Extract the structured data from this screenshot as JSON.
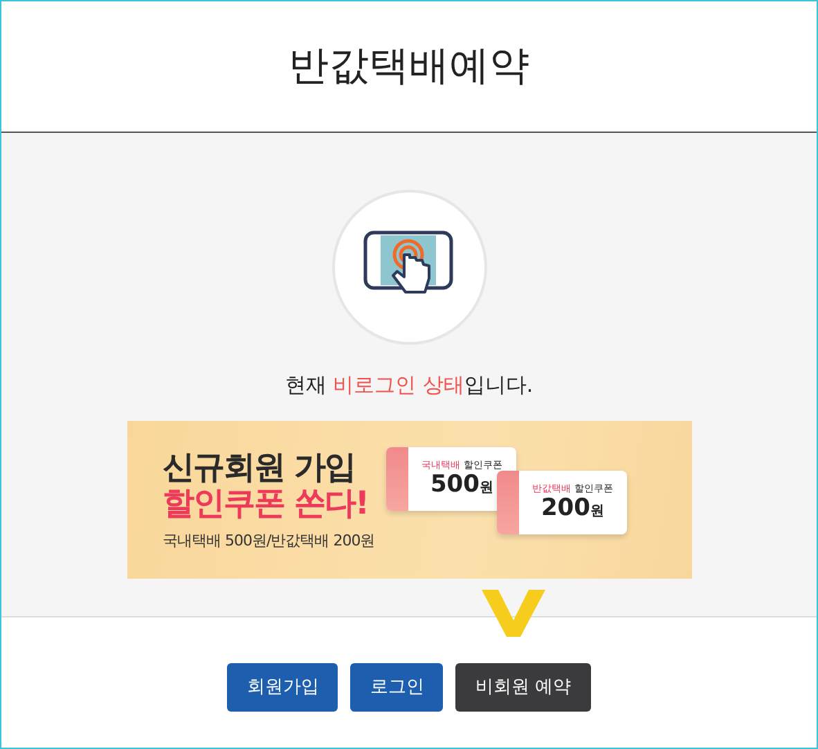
{
  "header": {
    "title": "반값택배예약"
  },
  "status": {
    "prefix": "현재 ",
    "highlight": "비로그인 상태",
    "suffix": "입니다."
  },
  "banner": {
    "headline": "신규회원 가입",
    "subheadline": "할인쿠폰 쏜다!",
    "caption": "국내택배 500원/반값택배 200원",
    "coupons": [
      {
        "category": "국내택배",
        "label": "할인쿠폰",
        "amount": "500",
        "unit": "원"
      },
      {
        "category": "반값택배",
        "label": "할인쿠폰",
        "amount": "200",
        "unit": "원"
      }
    ]
  },
  "buttons": [
    {
      "label": "회원가입",
      "kind": "primary"
    },
    {
      "label": "로그인",
      "kind": "primary"
    },
    {
      "label": "비회원 예약",
      "kind": "dark"
    }
  ]
}
